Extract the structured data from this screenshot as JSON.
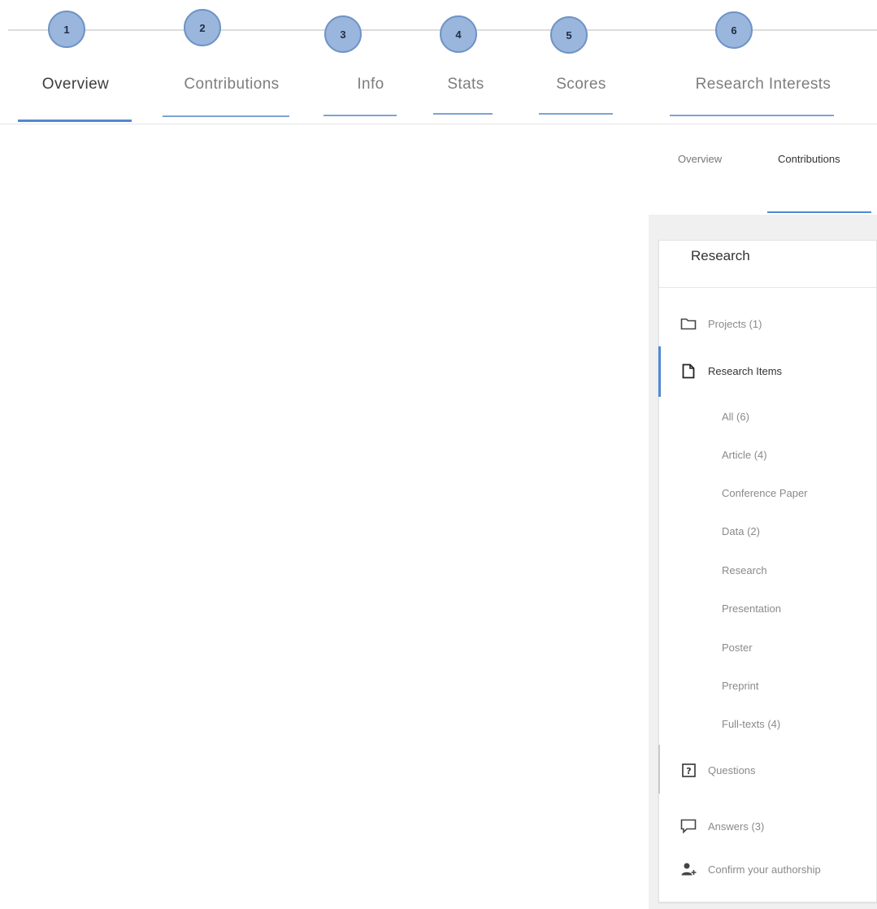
{
  "stepper": {
    "steps": [
      {
        "number": "1",
        "label": "Overview"
      },
      {
        "number": "2",
        "label": "Contributions"
      },
      {
        "number": "3",
        "label": "Info"
      },
      {
        "number": "4",
        "label": "Stats"
      },
      {
        "number": "5",
        "label": "Scores"
      },
      {
        "number": "6",
        "label": "Research Interests"
      }
    ],
    "active_index": 0
  },
  "panel": {
    "tabs": [
      {
        "label": "Overview"
      },
      {
        "label": "Contributions"
      }
    ],
    "active_tab": 1,
    "card_title": "Research",
    "menu": {
      "projects": {
        "label": "Projects (1)",
        "icon": "folder-icon"
      },
      "research_items": {
        "label": "Research Items",
        "icon": "document-icon"
      },
      "questions": {
        "label": "Questions",
        "icon": "question-icon"
      },
      "answers": {
        "label": "Answers (3)",
        "icon": "comment-icon"
      },
      "authorship": {
        "label": "Confirm your authorship",
        "icon": "person-add-icon"
      }
    },
    "sub_items": [
      "All (6)",
      "Article (4)",
      "Conference Paper",
      "Data (2)",
      "Research",
      "Presentation",
      "Poster",
      "Preprint",
      "Full-texts (4)"
    ]
  },
  "colors": {
    "accent": "#4f8ad1",
    "step_circle": "#9ab6dd",
    "panel_bg": "#f0f0f0"
  }
}
